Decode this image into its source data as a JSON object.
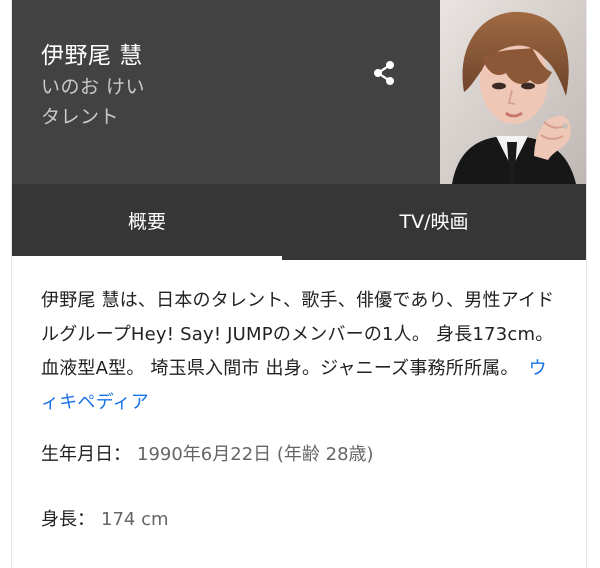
{
  "header": {
    "name": "伊野尾 慧",
    "reading": "いのお けい",
    "occupation": "タレント",
    "background_color": "#424242",
    "share_icon": "share-icon"
  },
  "tabs": [
    {
      "label": "概要",
      "selected": true
    },
    {
      "label": "TV/映画",
      "selected": false
    }
  ],
  "description": {
    "text": "伊野尾 慧は、日本のタレント、歌手、俳優であり、男性アイドルグループHey! Say! JUMPのメンバーの1人。 身長173cm。血液型A型。 埼玉県入間市 出身。ジャニーズ事務所所属。",
    "link_label": "ウィキペディア",
    "link_color": "#1a73e8"
  },
  "facts": {
    "birth": {
      "label": "生年月日：",
      "value": "1990年6月22日 (年齢 28歳)"
    },
    "height": {
      "label": "身長：",
      "value": "174 cm"
    }
  }
}
